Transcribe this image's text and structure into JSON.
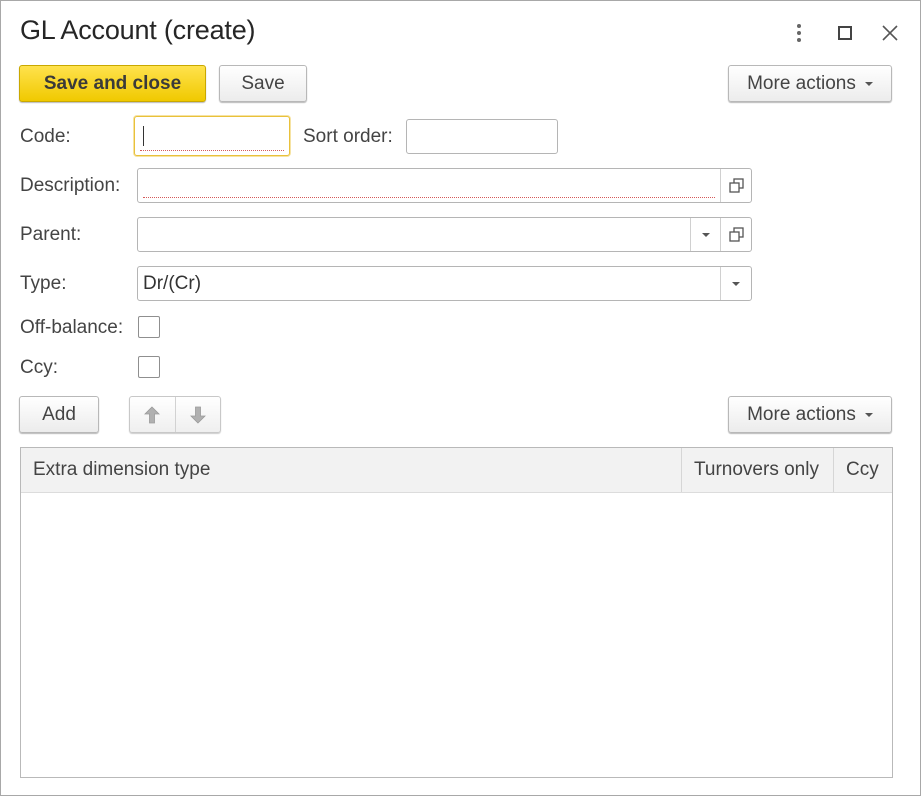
{
  "window": {
    "title": "GL Account (create)",
    "icons": [
      "more-vertical-icon",
      "maximize-icon",
      "close-icon"
    ]
  },
  "toolbar": {
    "save_and_close": "Save and close",
    "save": "Save",
    "more_actions": "More actions"
  },
  "form": {
    "code": {
      "label": "Code:",
      "value": ""
    },
    "sort_order": {
      "label": "Sort order:",
      "value": ""
    },
    "description": {
      "label": "Description:",
      "value": ""
    },
    "parent": {
      "label": "Parent:",
      "value": ""
    },
    "type": {
      "label": "Type:",
      "value": "Dr/(Cr)"
    },
    "off_balance": {
      "label": "Off-balance:",
      "checked": false
    },
    "ccy": {
      "label": "Ccy:",
      "checked": false
    }
  },
  "table_toolbar": {
    "add": "Add",
    "more_actions": "More actions",
    "icons": [
      "arrow-up-icon",
      "arrow-down-icon"
    ]
  },
  "table": {
    "columns": [
      "Extra dimension type",
      "Turnovers only",
      "Ccy"
    ],
    "rows": []
  },
  "colors": {
    "primary_button": "#f5d000",
    "focus_border": "#e9c13b",
    "required_underline": "#d55a5a"
  }
}
